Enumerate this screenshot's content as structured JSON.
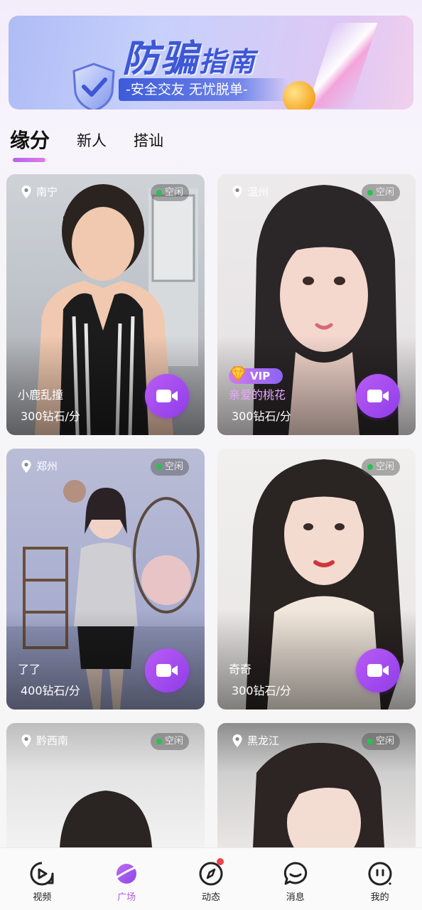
{
  "banner": {
    "title_main": "防骗",
    "title_small": "指南",
    "subtitle": "-安全交友 无忧脱单-"
  },
  "tabs": [
    {
      "label": "缘分",
      "active": true
    },
    {
      "label": "新人",
      "active": false
    },
    {
      "label": "搭讪",
      "active": false
    }
  ],
  "cards": [
    {
      "location": "南宁",
      "status": "空闲",
      "name": "小鹿乱撞",
      "price": "300钻石/分",
      "vip": false
    },
    {
      "location": "温州",
      "status": "空闲",
      "name": "亲爱的桃花",
      "price": "300钻石/分",
      "vip": true,
      "vip_label": "VIP"
    },
    {
      "location": "郑州",
      "status": "空闲",
      "name": "了了",
      "price": "400钻石/分",
      "vip": false
    },
    {
      "location": "",
      "status": "空闲",
      "name": "奇奇",
      "price": "300钻石/分",
      "vip": false
    },
    {
      "location": "黔西南",
      "status": "空闲",
      "name": "",
      "price": "",
      "vip": false
    },
    {
      "location": "黑龙江",
      "status": "空闲",
      "name": "",
      "price": "",
      "vip": false
    }
  ],
  "nav": [
    {
      "label": "视频",
      "icon": "video-play-icon",
      "active": false
    },
    {
      "label": "广场",
      "icon": "planet-icon",
      "active": true
    },
    {
      "label": "动态",
      "icon": "compass-icon",
      "active": false,
      "badge": true
    },
    {
      "label": "消息",
      "icon": "chat-bubble-icon",
      "active": false
    },
    {
      "label": "我的",
      "icon": "face-icon",
      "active": false
    }
  ],
  "colors": {
    "accent": "#b05be8",
    "status_dot": "#27c24c",
    "banner_blue": "#3d57d6"
  }
}
